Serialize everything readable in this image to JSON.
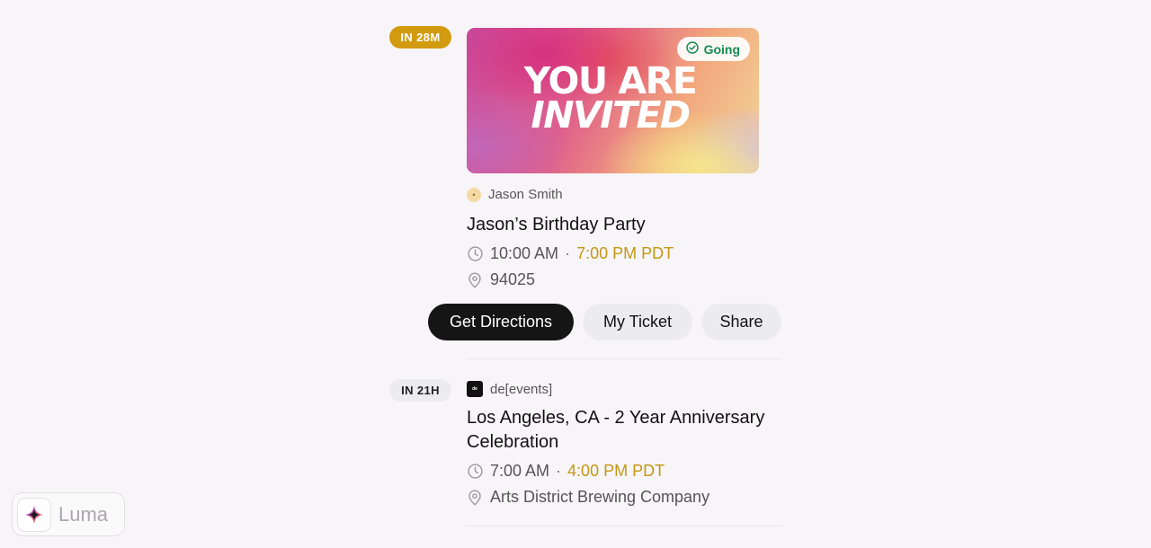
{
  "events": [
    {
      "badge": "IN 28M",
      "cover_line1": "YOU ARE",
      "cover_line2": "INVITED",
      "status": "Going",
      "host": "Jason Smith",
      "title": "Jason’s Birthday Party",
      "time_start": "10:00 AM",
      "separator": "·",
      "time_local": "7:00 PM PDT",
      "location": "94025",
      "actions": {
        "directions": "Get Directions",
        "ticket": "My Ticket",
        "share": "Share"
      }
    },
    {
      "badge": "IN 21H",
      "host": "de[events]",
      "title": "Los Angeles, CA -  2 Year Anniversary Celebration",
      "time_start": "7:00 AM",
      "separator": "·",
      "time_local": "4:00 PM PDT",
      "location": "Arts District Brewing Company"
    }
  ],
  "branding": {
    "name": "Luma"
  },
  "colors": {
    "badge_live": "#d29a0e",
    "local_time": "#c39713",
    "going": "#158a4f",
    "primary_button": "#151515"
  },
  "icons": {
    "status": "check-circle-icon",
    "time": "clock-icon",
    "location": "map-pin-icon",
    "logo": "sparkle-star-icon"
  }
}
